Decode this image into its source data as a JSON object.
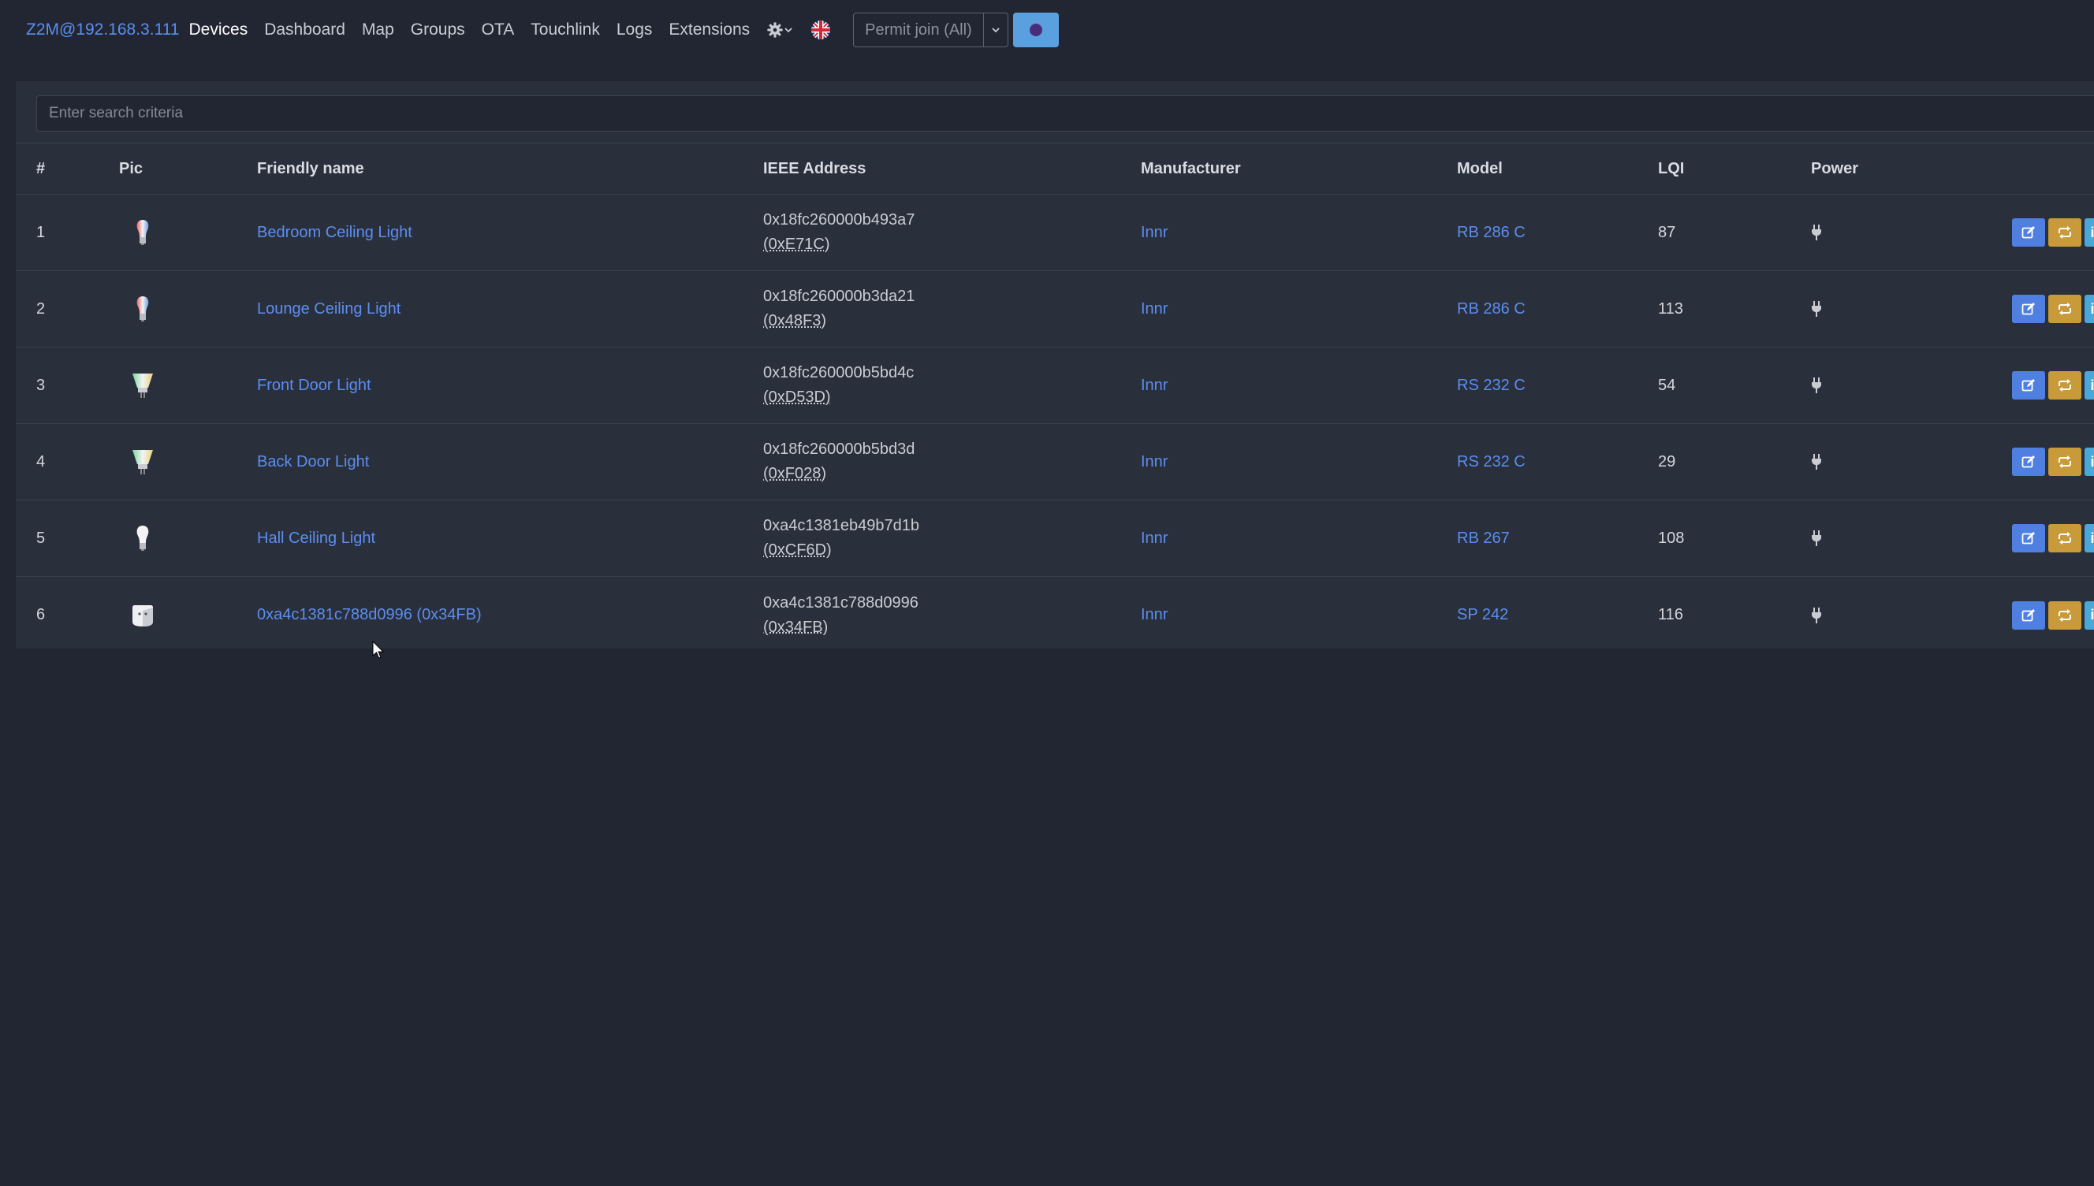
{
  "nav": {
    "brand": "Z2M@192.168.3.111",
    "links": [
      "Devices",
      "Dashboard",
      "Map",
      "Groups",
      "OTA",
      "Touchlink",
      "Logs",
      "Extensions"
    ],
    "settings_icon": "gear-icon",
    "language_icon": "uk-flag-icon",
    "permit_join_label": "Permit join (All)",
    "colors": {
      "brand": "#5b8ef0",
      "join_button": "#5ba0de"
    }
  },
  "search": {
    "placeholder": "Enter search criteria",
    "value": ""
  },
  "table": {
    "headers": {
      "num": "#",
      "pic": "Pic",
      "name": "Friendly name",
      "ieee": "IEEE Address",
      "manufacturer": "Manufacturer",
      "model": "Model",
      "lqi": "LQI",
      "power": "Power"
    },
    "rows": [
      {
        "num": "1",
        "pic": "color-bulb-icon",
        "name": "Bedroom Ceiling Light",
        "ieee": "0x18fc260000b493a7",
        "nwk": "(0xE71C)",
        "manufacturer": "Innr",
        "model": "RB 286 C",
        "lqi": "87",
        "power": "plug-icon"
      },
      {
        "num": "2",
        "pic": "color-bulb-icon",
        "name": "Lounge Ceiling Light",
        "ieee": "0x18fc260000b3da21",
        "nwk": "(0x48F3)",
        "manufacturer": "Innr",
        "model": "RB 286 C",
        "lqi": "113",
        "power": "plug-icon"
      },
      {
        "num": "3",
        "pic": "spot-bulb-icon",
        "name": "Front Door Light",
        "ieee": "0x18fc260000b5bd4c",
        "nwk": "(0xD53D)",
        "manufacturer": "Innr",
        "model": "RS 232 C",
        "lqi": "54",
        "power": "plug-icon"
      },
      {
        "num": "4",
        "pic": "spot-bulb-icon",
        "name": "Back Door Light",
        "ieee": "0x18fc260000b5bd3d",
        "nwk": "(0xF028)",
        "manufacturer": "Innr",
        "model": "RS 232 C",
        "lqi": "29",
        "power": "plug-icon"
      },
      {
        "num": "5",
        "pic": "white-bulb-icon",
        "name": "Hall Ceiling Light",
        "ieee": "0xa4c1381eb49b7d1b",
        "nwk": "(0xCF6D)",
        "manufacturer": "Innr",
        "model": "RB 267",
        "lqi": "108",
        "power": "plug-icon"
      },
      {
        "num": "6",
        "pic": "smart-plug-icon",
        "name": "0xa4c1381c788d0996 (0x34FB)",
        "ieee": "0xa4c1381c788d0996",
        "nwk": "(0x34FB)",
        "manufacturer": "Innr",
        "model": "SP 242",
        "lqi": "116",
        "power": "plug-icon"
      }
    ],
    "actions": {
      "edit_icon": "edit-icon",
      "reconfigure_icon": "refresh-icon",
      "info_label": "i"
    },
    "colors": {
      "link": "#5b8ef0",
      "edit": "#4f7fe0",
      "reconfigure": "#c99a3a",
      "info": "#4aa8d8"
    }
  }
}
